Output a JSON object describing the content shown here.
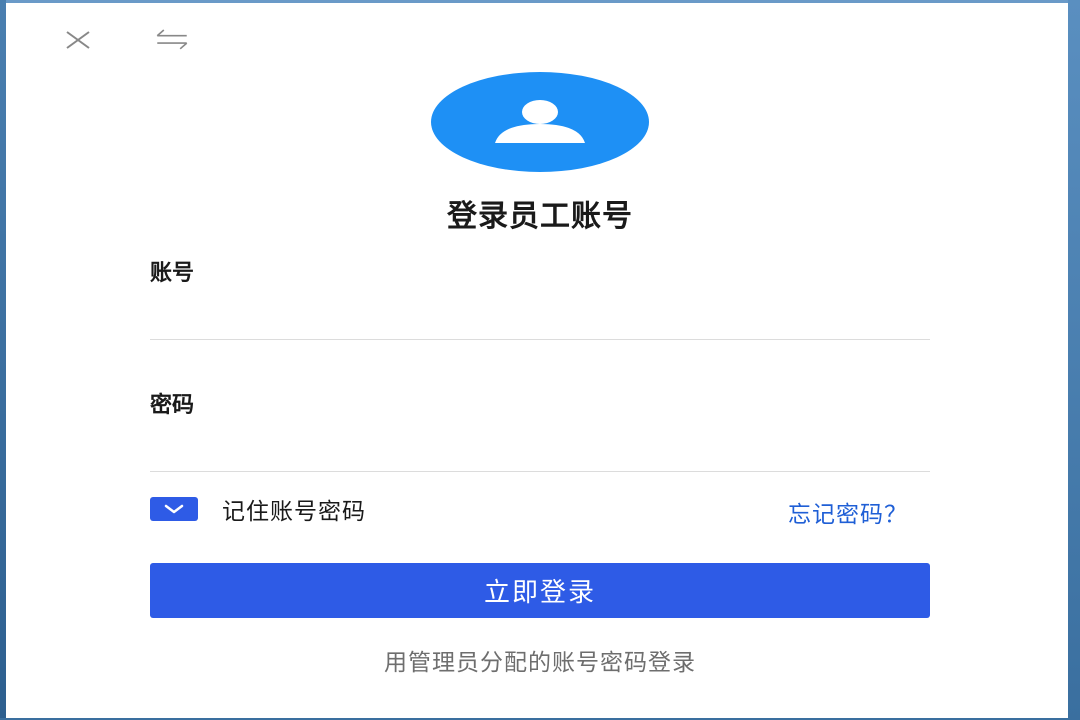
{
  "window": {
    "close_icon": "close-icon",
    "switch_icon": "switch-arrows-icon"
  },
  "avatar": {
    "icon": "user-icon",
    "color": "#1e90f5"
  },
  "login": {
    "title": "登录员工账号",
    "account_label": "账号",
    "account_value": "",
    "password_label": "密码",
    "password_value": "",
    "remember_label": "记住账号密码",
    "remember_checked": true,
    "forgot_label": "忘记密码？",
    "submit_label": "立即登录",
    "hint": "用管理员分配的账号密码登录"
  },
  "colors": {
    "primary": "#2e5be6",
    "link": "#1f5fd6",
    "avatar": "#1e90f5"
  }
}
